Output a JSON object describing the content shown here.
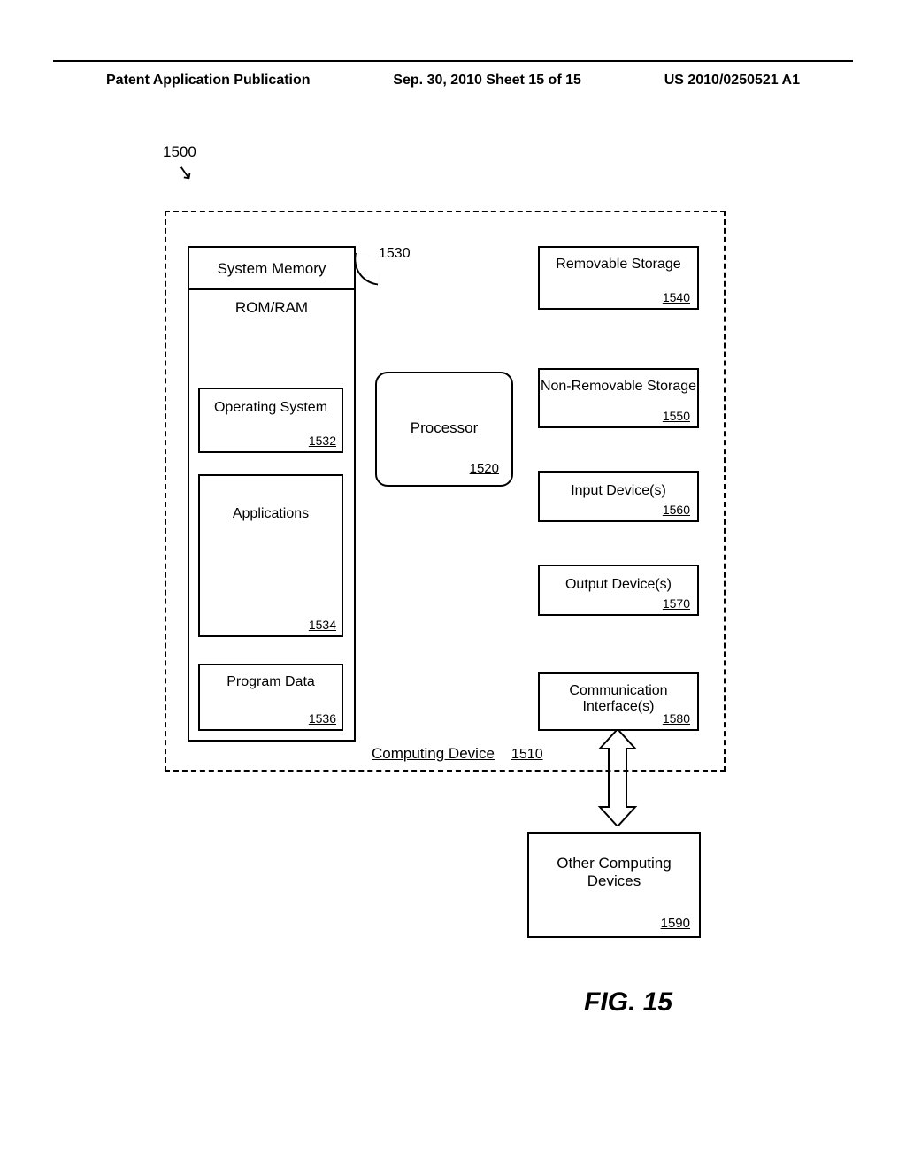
{
  "header": {
    "left": "Patent Application Publication",
    "center": "Sep. 30, 2010  Sheet 15 of 15",
    "right": "US 2010/0250521 A1"
  },
  "figure_ref": "1500",
  "device": {
    "label": "Computing Device",
    "ref": "1510"
  },
  "sysmem": {
    "title": "System Memory",
    "romram": "ROM/RAM",
    "os": {
      "label": "Operating System",
      "ref": "1532"
    },
    "apps": {
      "label": "Applications",
      "ref": "1534"
    },
    "pdata": {
      "label": "Program Data",
      "ref": "1536"
    },
    "pointer_ref": "1530"
  },
  "processor": {
    "label": "Processor",
    "ref": "1520"
  },
  "right_boxes": {
    "removable": {
      "label": "Removable Storage",
      "ref": "1540"
    },
    "nonremovable": {
      "label": "Non-Removable Storage",
      "ref": "1550"
    },
    "inputdev": {
      "label": "Input Device(s)",
      "ref": "1560"
    },
    "outputdev": {
      "label": "Output Device(s)",
      "ref": "1570"
    },
    "comm": {
      "label": "Communication Interface(s)",
      "ref": "1580"
    }
  },
  "other_dev": {
    "label": "Other Computing Devices",
    "ref": "1590"
  },
  "caption": "FIG. 15"
}
